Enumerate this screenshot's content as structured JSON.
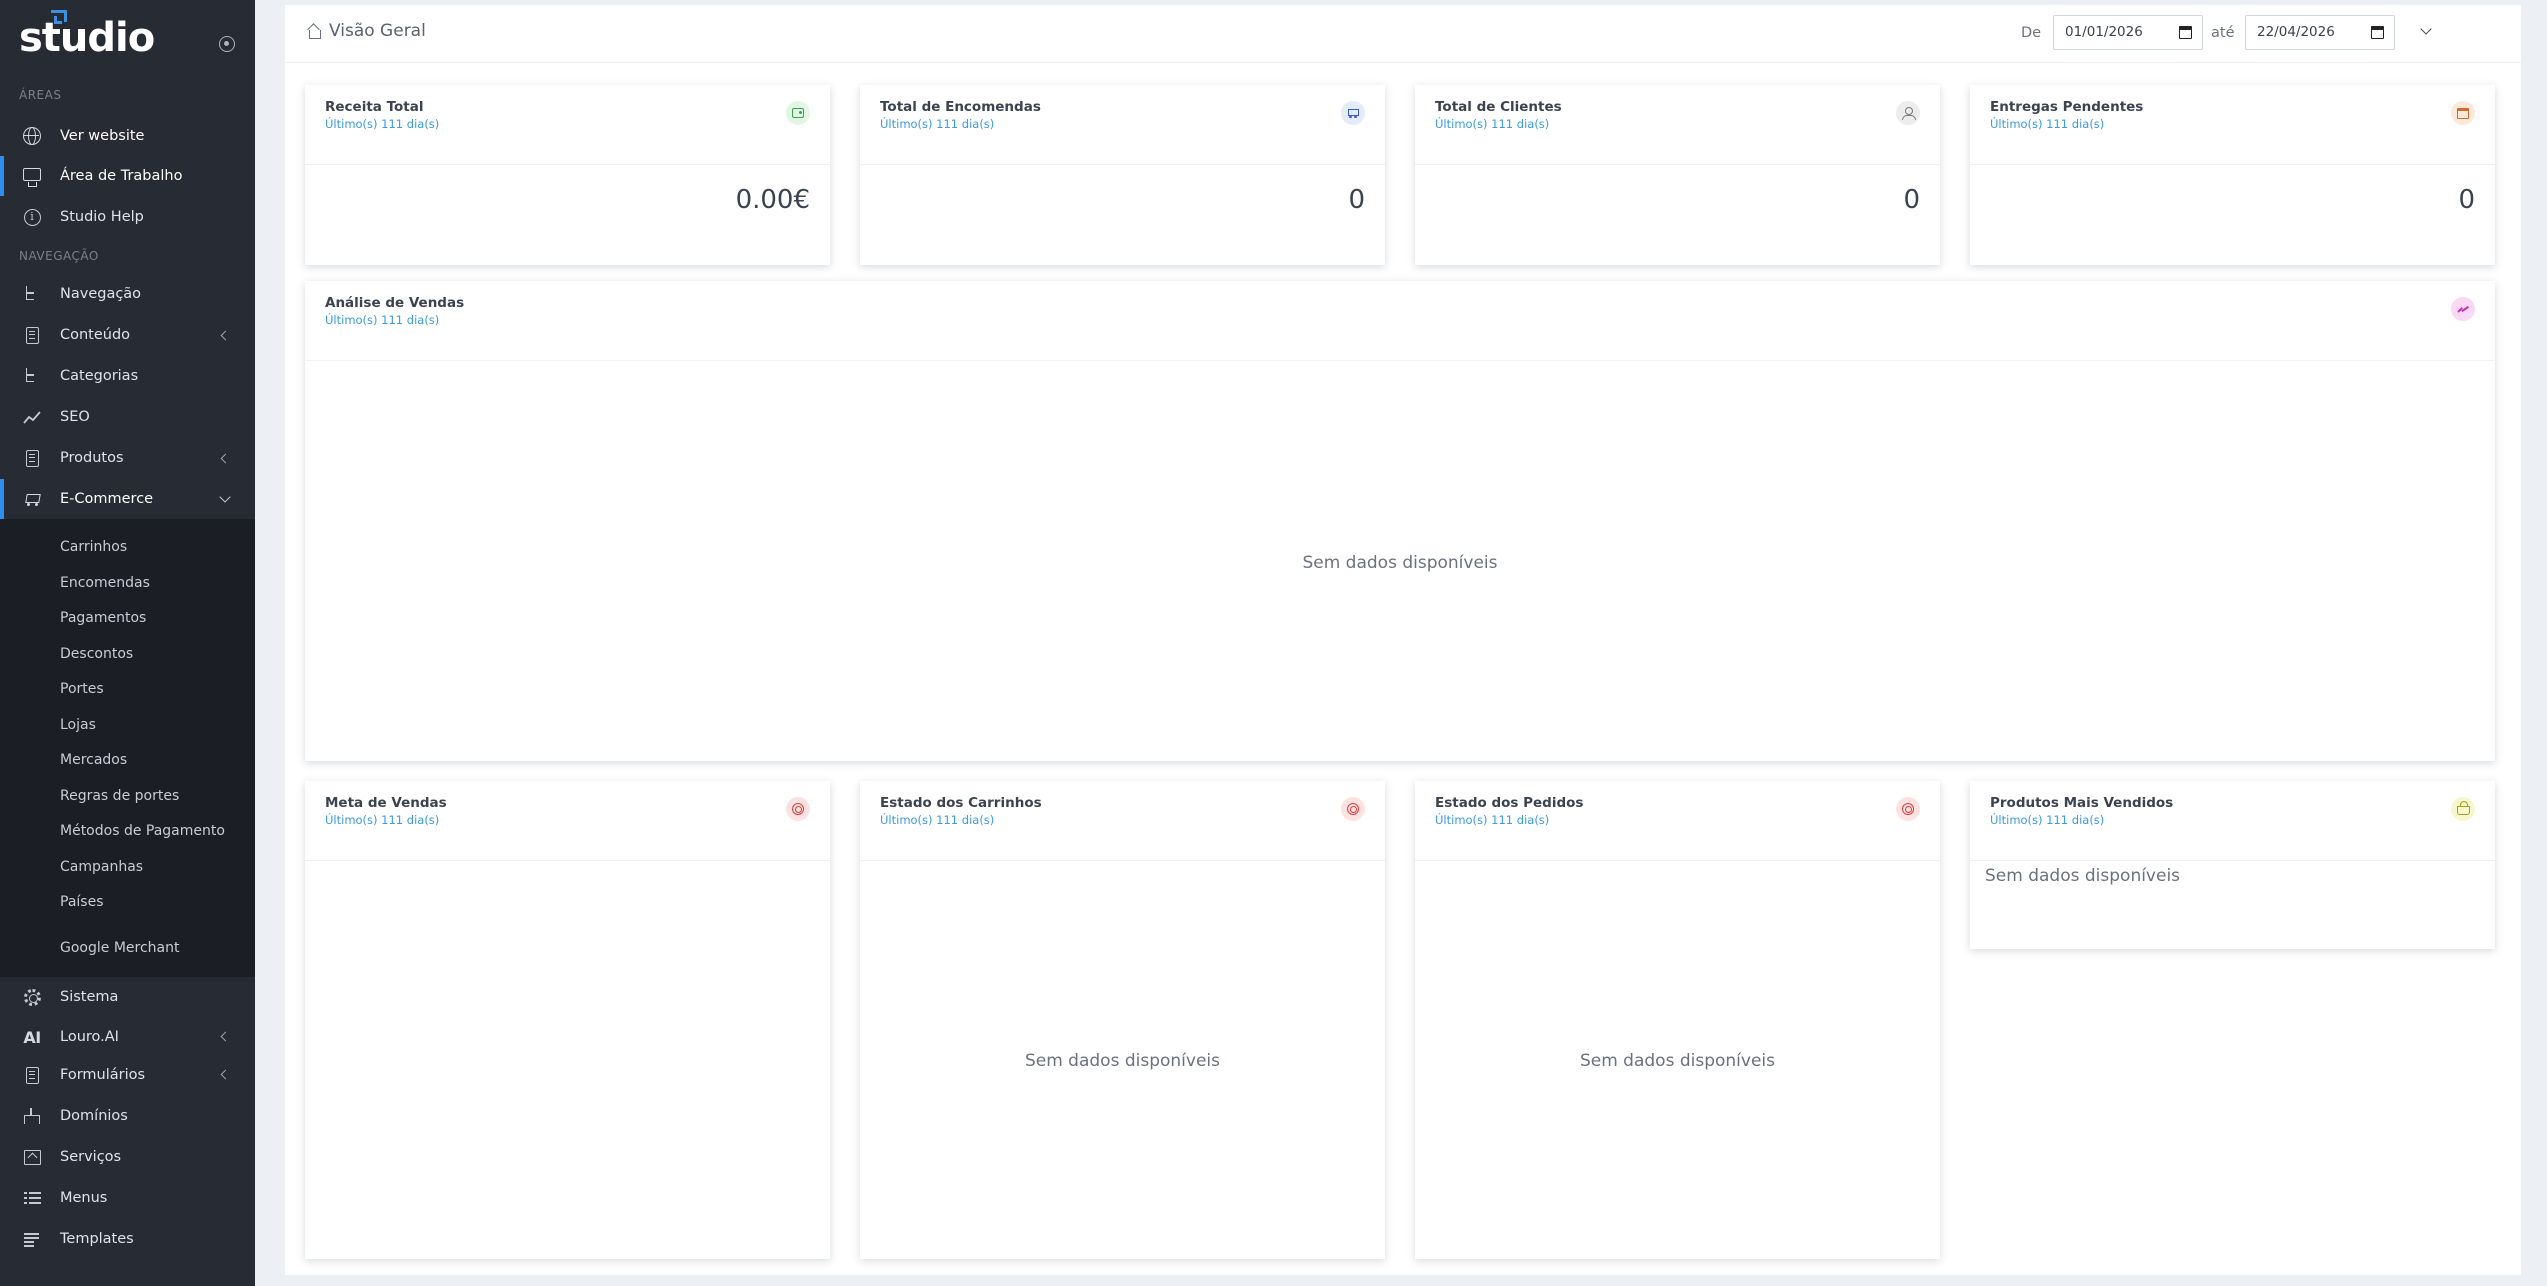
{
  "sidebar": {
    "logo_text": "studio",
    "sections": {
      "areas": "ÁREAS",
      "navegacao": "NAVEGAÇÃO"
    },
    "items": {
      "ver_website": "Ver website",
      "area_trabalho": "Área de Trabalho",
      "studio_help": "Studio Help",
      "navegacao": "Navegação",
      "conteudo": "Conteúdo",
      "categorias": "Categorias",
      "seo": "SEO",
      "produtos": "Produtos",
      "ecommerce": "E-Commerce",
      "sistema": "Sistema",
      "louro_ai": "Louro.AI",
      "formularios": "Formulários",
      "dominios": "Domínios",
      "servicos": "Serviços",
      "menus": "Menus",
      "templates": "Templates"
    },
    "ai_icon_text": "AI",
    "ecommerce_submenu": [
      "Carrinhos",
      "Encomendas",
      "Pagamentos",
      "Descontos",
      "Portes",
      "Lojas",
      "Mercados",
      "Regras de portes",
      "Métodos de Pagamento",
      "Campanhas",
      "Países",
      "Google Merchant"
    ]
  },
  "header": {
    "title": "Visão Geral",
    "from_label": "De",
    "from_date": "01/01/2026",
    "to_label": "até",
    "to_date": "22/04/2026"
  },
  "period_label": "Último(s) 111 dia(s)",
  "empty_text": "Sem dados disponíveis",
  "stats": {
    "receita": {
      "title": "Receita Total",
      "value": "0.00€"
    },
    "encomendas": {
      "title": "Total de Encomendas",
      "value": "0"
    },
    "clientes": {
      "title": "Total de Clientes",
      "value": "0"
    },
    "entregas": {
      "title": "Entregas Pendentes",
      "value": "0"
    }
  },
  "analise": {
    "title": "Análise de Vendas"
  },
  "meta": {
    "title": "Meta de Vendas"
  },
  "carrinhos": {
    "title": "Estado dos Carrinhos"
  },
  "pedidos": {
    "title": "Estado dos Pedidos"
  },
  "produtos_vendidos": {
    "title": "Produtos Mais Vendidos"
  },
  "colors": {
    "sidebar_bg": "#272b34",
    "accent": "#2d8ff0",
    "period_text": "#3a9ae4"
  }
}
